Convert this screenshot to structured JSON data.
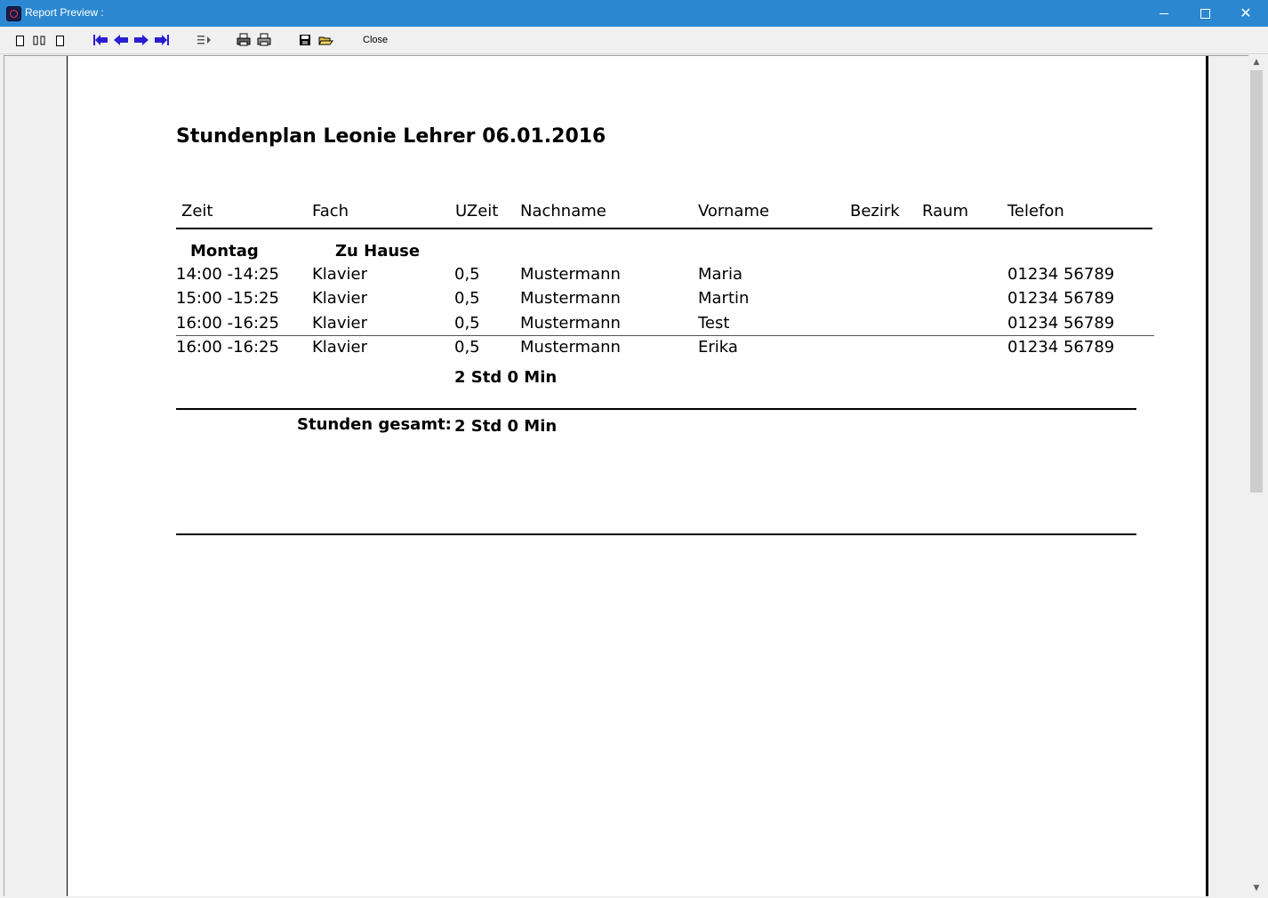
{
  "window": {
    "title": "Report Preview :"
  },
  "toolbar": {
    "close_label": "Close"
  },
  "report": {
    "title": "Stundenplan Leonie Lehrer 06.01.2016",
    "columns": {
      "zeit": "Zeit",
      "fach": "Fach",
      "uzeit": "UZeit",
      "nachname": "Nachname",
      "vorname": "Vorname",
      "bezirk": "Bezirk",
      "raum": "Raum",
      "telefon": "Telefon"
    },
    "group": {
      "day": "Montag",
      "location": "Zu Hause"
    },
    "rows": [
      {
        "zeit": "14:00 -14:25",
        "fach": "Klavier",
        "uzeit": "0,5",
        "nachname": "Mustermann",
        "vorname": "Maria",
        "telefon": "01234 56789"
      },
      {
        "zeit": "15:00 -15:25",
        "fach": "Klavier",
        "uzeit": "0,5",
        "nachname": "Mustermann",
        "vorname": "Martin",
        "telefon": "01234 56789"
      },
      {
        "zeit": "16:00 -16:25",
        "fach": "Klavier",
        "uzeit": "0,5",
        "nachname": "Mustermann",
        "vorname": "Test",
        "telefon": "01234 56789"
      },
      {
        "zeit": "16:00 -16:25",
        "fach": "Klavier",
        "uzeit": "0,5",
        "nachname": "Mustermann",
        "vorname": "Erika",
        "telefon": "01234 56789"
      }
    ],
    "group_total": "2 Std  0 Min",
    "grand_total_label": "Stunden gesamt:",
    "grand_total": "2 Std  0 Min"
  },
  "colors": {
    "titlebar": "#2b88d0",
    "nav_arrows": "#2a1fd0"
  },
  "icons": [
    "single-page-icon",
    "two-pages-icon",
    "page-width-icon",
    "first-page-icon",
    "previous-page-icon",
    "next-page-icon",
    "last-page-icon",
    "goto-page-icon",
    "printer-setup-icon",
    "print-icon",
    "save-icon",
    "open-icon"
  ]
}
